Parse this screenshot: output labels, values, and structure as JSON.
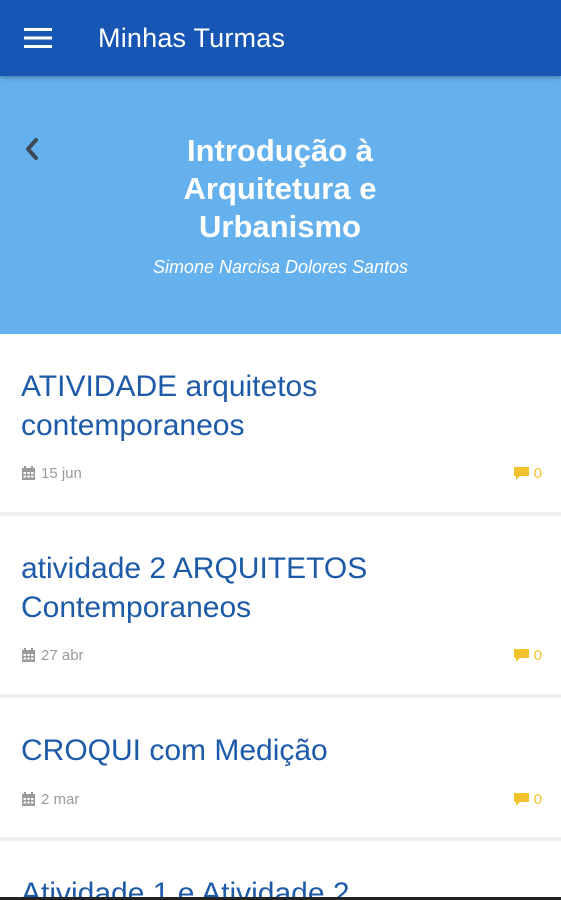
{
  "appbar": {
    "title": "Minhas Turmas",
    "menu_icon": "hamburger-menu-icon"
  },
  "header": {
    "back_icon": "chevron-left-icon",
    "course_title": "Introdução à Arquitetura e Urbanismo",
    "teacher": "Simone Narcisa Dolores Santos",
    "background_color": "#64b1ee"
  },
  "activities": [
    {
      "title": "ATIVIDADE arquitetos contemporaneos",
      "date": "15 jun",
      "comments": "0"
    },
    {
      "title": "atividade 2 ARQUITETOS Contemporaneos",
      "date": "27 abr",
      "comments": "0"
    },
    {
      "title": "CROQUI com Medição",
      "date": "2 mar",
      "comments": "0"
    },
    {
      "title": "Atividade 1 e Atividade 2",
      "date": "",
      "comments": ""
    }
  ],
  "colors": {
    "appbar": "#1757b3",
    "activity_title": "#1d5aa8",
    "comment_accent": "#f2c12e"
  }
}
